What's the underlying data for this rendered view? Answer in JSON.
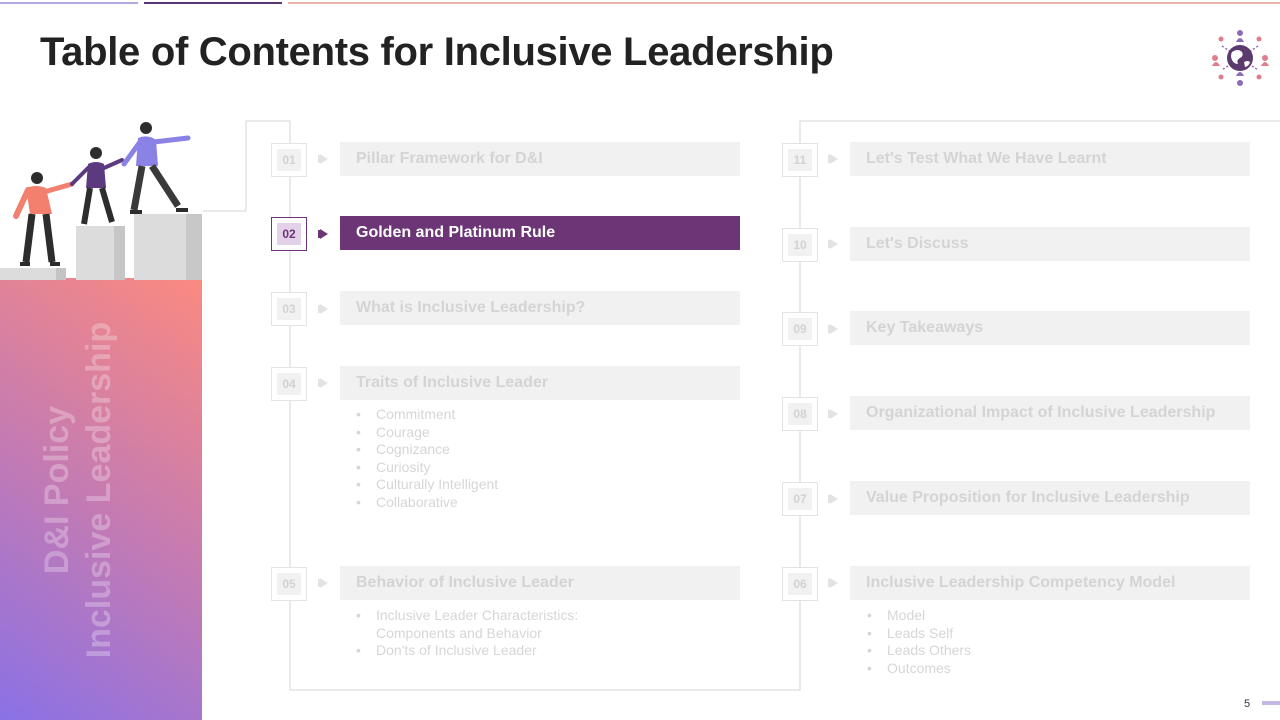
{
  "slide": {
    "title": "Table of Contents for Inclusive Leadership",
    "page_number": "5"
  },
  "sidebar": {
    "text_line1": "D&I Policy",
    "text_line2": "Inclusive Leadership"
  },
  "left_column": [
    {
      "num": "01",
      "label": "Pillar Framework for D&I",
      "active": false
    },
    {
      "num": "02",
      "label": "Golden and Platinum Rule",
      "active": true
    },
    {
      "num": "03",
      "label": "What is Inclusive Leadership?",
      "active": false
    },
    {
      "num": "04",
      "label": "Traits of Inclusive Leader",
      "active": false,
      "bullets": [
        "Commitment",
        "Courage",
        "Cognizance",
        "Curiosity",
        "Culturally Intelligent",
        "Collaborative"
      ]
    },
    {
      "num": "05",
      "label": "Behavior of Inclusive Leader",
      "active": false,
      "bullets": [
        "Inclusive Leader Characteristics:",
        "Components and Behavior",
        "Don'ts of Inclusive Leader"
      ]
    }
  ],
  "right_column": [
    {
      "num": "11",
      "label": "Let's Test What We Have Learnt"
    },
    {
      "num": "10",
      "label": "Let's Discuss"
    },
    {
      "num": "09",
      "label": "Key Takeaways"
    },
    {
      "num": "08",
      "label": "Organizational Impact of Inclusive Leadership"
    },
    {
      "num": "07",
      "label": "Value Proposition for Inclusive Leadership"
    },
    {
      "num": "06",
      "label": "Inclusive Leadership Competency Model",
      "bullets": [
        "Model",
        "Leads Self",
        "Leads Others",
        "Outcomes"
      ]
    }
  ],
  "colors": {
    "accent": "#6b3576",
    "accent_light": "#e3d1ea",
    "inactive_box": "#f1f1f1",
    "inactive_text": "#d4d4d4",
    "gradient_start": "#8a71e6",
    "gradient_end": "#fb8a80"
  },
  "icons": {
    "logo": "globe-people-icon",
    "item_arrow": "arrow-right-icon"
  }
}
